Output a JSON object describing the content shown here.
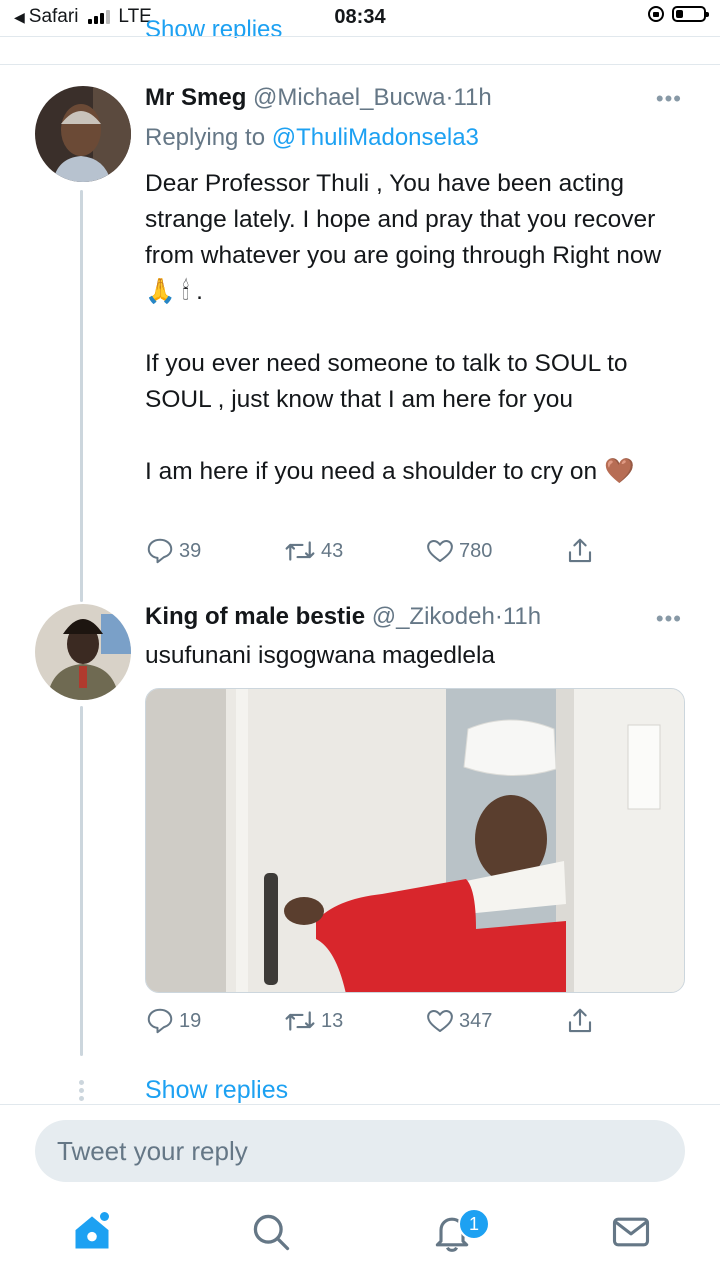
{
  "status_bar": {
    "back_app": "Safari",
    "network": "LTE",
    "time": "08:34"
  },
  "previous": {
    "show_replies_partial": "Show replies"
  },
  "tweets": [
    {
      "name": "Mr Smeg",
      "handle": "@Michael_Bucwa",
      "time": "11h",
      "replying_to_label": "Replying to",
      "replying_to": "@ThuliMadonsela3",
      "text": [
        "Dear Professor Thuli , You have been acting strange lately. I hope and pray that you recover from whatever you are going through Right now 🙏 🕯 .",
        "If you ever need someone to talk to SOUL to SOUL , just know that I am here for you",
        "I am here if you need a shoulder to cry on 🤎"
      ],
      "replies": "39",
      "retweets": "43",
      "likes": "780"
    },
    {
      "name": "King of male bestie",
      "handle": "@_Zikodeh",
      "time": "11h",
      "text": [
        "usufunani isgogwana magedlela"
      ],
      "replies": "19",
      "retweets": "13",
      "likes": "347"
    }
  ],
  "show_replies": "Show replies",
  "reply_box": {
    "placeholder": "Tweet your reply"
  },
  "tabbar": {
    "items": [
      "home-icon",
      "search-icon",
      "notifications-icon",
      "messages-icon"
    ],
    "notifications_badge": "1",
    "accent": "#1da1f2"
  }
}
